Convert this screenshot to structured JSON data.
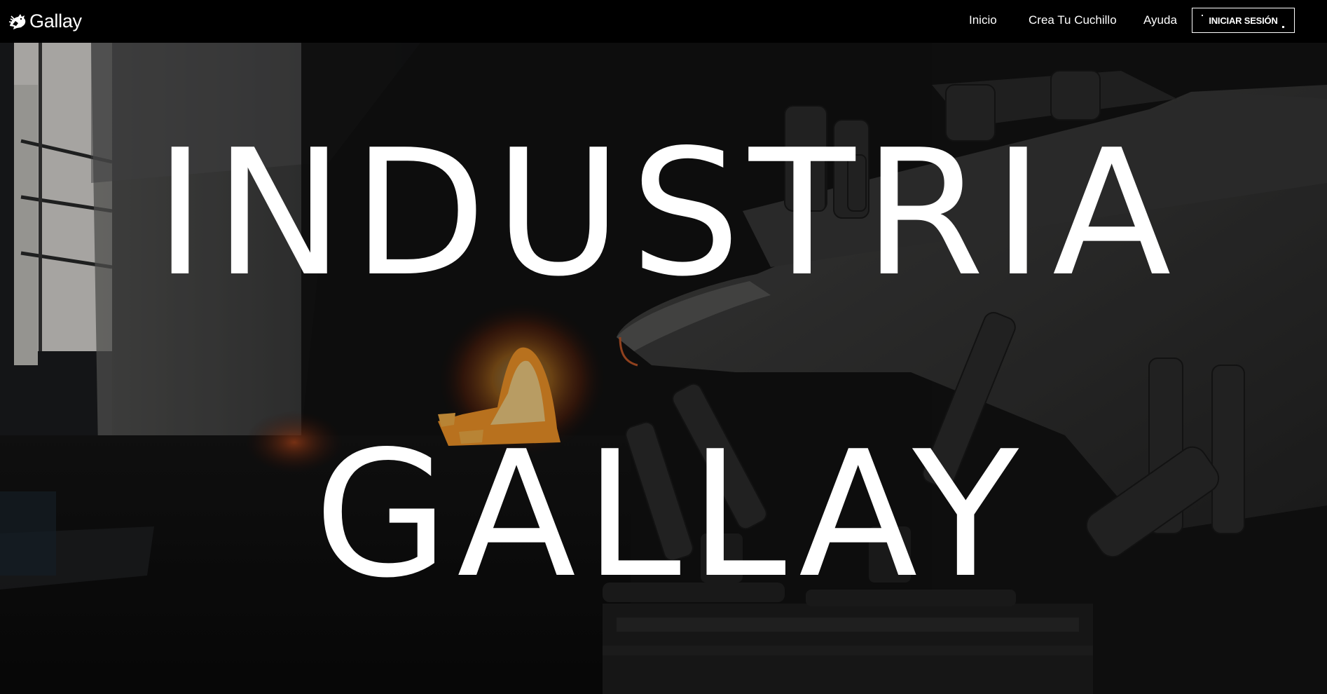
{
  "header": {
    "brand": {
      "name": "Gallay",
      "icon": "rooster-logo-icon"
    },
    "nav": [
      {
        "label": "Inicio"
      },
      {
        "label": "Crea Tu Cuchillo"
      },
      {
        "label": "Ayuda"
      }
    ],
    "login_label": "INICIAR SESIÓN"
  },
  "hero": {
    "background": "blacksmith-forge-anvil-photo",
    "title_line_1": "INDUSTRIA",
    "title_line_2": "GALLAY"
  },
  "colors": {
    "navbar_bg": "#000000",
    "text": "#ffffff",
    "forge_glow": "#ff8a1e"
  }
}
